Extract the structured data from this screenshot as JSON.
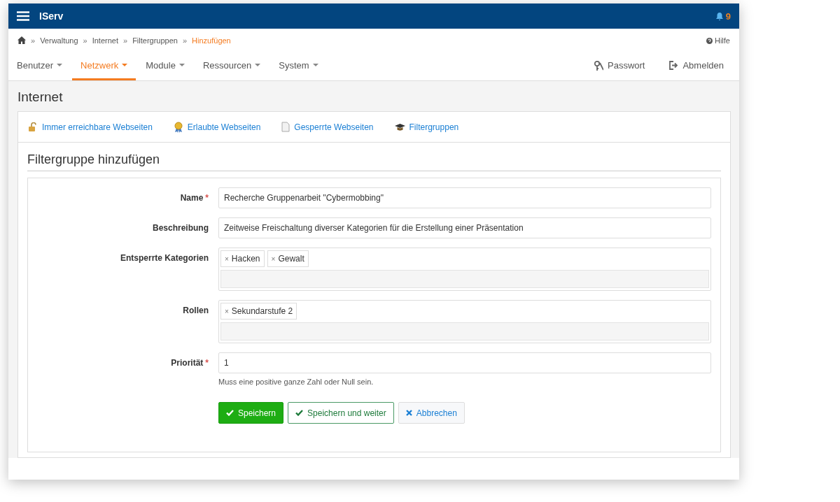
{
  "header": {
    "title": "IServ",
    "notification_count": "9"
  },
  "breadcrumb": [
    {
      "label": "Verwaltung",
      "selected": false
    },
    {
      "label": "Internet",
      "selected": false
    },
    {
      "label": "Filtergruppen",
      "selected": false
    },
    {
      "label": "Hinzufügen",
      "selected": true
    }
  ],
  "breadcrumb_separator": "»",
  "help_link": "Hilfe",
  "nav": [
    {
      "label": "Benutzer",
      "selected": false
    },
    {
      "label": "Netzwerk",
      "selected": true
    },
    {
      "label": "Module",
      "selected": false
    },
    {
      "label": "Ressourcen",
      "selected": false
    },
    {
      "label": "System",
      "selected": false
    }
  ],
  "nav_right": [
    {
      "kind": "password",
      "label": "Passwort"
    },
    {
      "kind": "logout",
      "label": "Abmelden"
    }
  ],
  "page_title": "Internet",
  "subnav": [
    {
      "kind": "lock",
      "label": "Immer erreichbare Webseiten"
    },
    {
      "kind": "award",
      "label": "Erlaubte Webseiten"
    },
    {
      "kind": "document",
      "label": "Gesperrte Webseiten"
    },
    {
      "kind": "cap",
      "label": "Filtergruppen"
    }
  ],
  "form": {
    "title": "Filtergruppe hinzufügen",
    "fields": [
      {
        "kind": "text",
        "label": "Name",
        "required_mark": "*",
        "value": "Recherche Gruppenarbeit \"Cybermobbing\""
      },
      {
        "kind": "text",
        "label": "Beschreibung",
        "value": "Zeitweise Freischaltung diverser Kategorien für die Erstellung einer Präsentation"
      },
      {
        "kind": "tags",
        "label": "Entsperrte Kategorien",
        "tags": [
          "Hacken",
          "Gewalt"
        ]
      },
      {
        "kind": "tags",
        "label": "Rollen",
        "tags": [
          "Sekundarstufe 2"
        ]
      },
      {
        "kind": "text",
        "label": "Priorität",
        "required_mark": "*",
        "value": "1",
        "help": "Muss eine positive ganze Zahl oder Null sein."
      }
    ],
    "tag_remove": "×",
    "buttons": [
      {
        "kind": "primary",
        "label": "Speichern"
      },
      {
        "kind": "outline",
        "label": "Speichern und weiter"
      },
      {
        "kind": "cancel",
        "label": "Abbrechen"
      }
    ]
  }
}
